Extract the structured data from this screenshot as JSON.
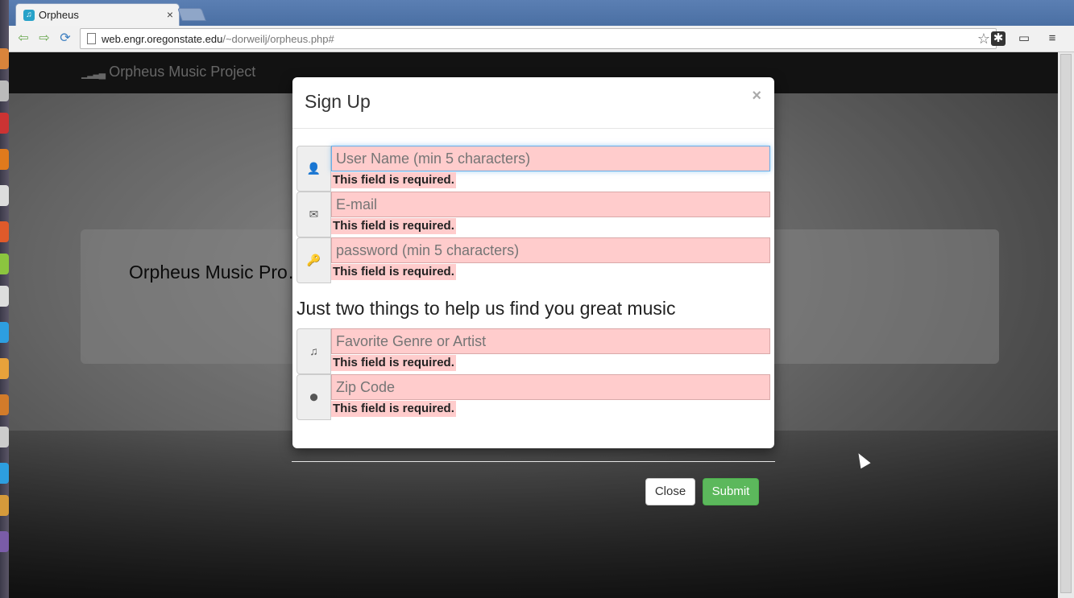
{
  "browser": {
    "tab_title": "Orpheus",
    "tab_close": "×",
    "url_host": "web.engr.oregonstate.edu",
    "url_path": "/~dorweilj/orpheus.php#"
  },
  "navbar": {
    "brand": "Orpheus Music Project"
  },
  "jumbotron": {
    "text": "Orpheus Music Pro…                                                                 for songs and genres, add songs …                                                                                      n."
  },
  "modal": {
    "title": "Sign Up",
    "close": "×",
    "fields": [
      {
        "icon": "user-icon",
        "glyph": "👤",
        "placeholder": "User Name (min 5 characters)",
        "error": "This field is required."
      },
      {
        "icon": "envelope-icon",
        "glyph": "✉",
        "placeholder": "E-mail",
        "error": "This field is required."
      },
      {
        "icon": "key-icon",
        "glyph": "🔑",
        "placeholder": "password (min 5 characters)",
        "error": "This field is required."
      },
      {
        "icon": "music-icon",
        "glyph": "♫",
        "placeholder": "Favorite Genre or Artist",
        "error": "This field is required."
      },
      {
        "icon": "map-marker-icon",
        "glyph": "⬤",
        "placeholder": "Zip Code",
        "error": "This field is required."
      }
    ],
    "subheading": "Just two things to help us find you great music"
  },
  "footer": {
    "close_label": "Close",
    "submit_label": "Submit"
  },
  "colors": {
    "error_bg": "#ffcccc",
    "submit_green": "#5cb85c",
    "navbar": "#1d1d1d"
  }
}
